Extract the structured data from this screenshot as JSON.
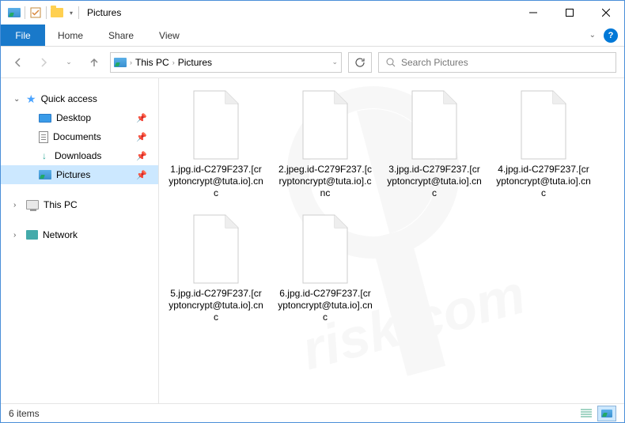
{
  "titlebar": {
    "title": "Pictures"
  },
  "ribbon": {
    "file": "File",
    "tabs": [
      "Home",
      "Share",
      "View"
    ]
  },
  "breadcrumb": [
    "This PC",
    "Pictures"
  ],
  "search": {
    "placeholder": "Search Pictures"
  },
  "sidebar": {
    "quick_access": "Quick access",
    "items": [
      {
        "label": "Desktop",
        "pinned": true
      },
      {
        "label": "Documents",
        "pinned": true
      },
      {
        "label": "Downloads",
        "pinned": true
      },
      {
        "label": "Pictures",
        "pinned": true,
        "selected": true
      }
    ],
    "this_pc": "This PC",
    "network": "Network"
  },
  "files": [
    {
      "name": "1.jpg.id-C279F237.[cryptoncrypt@tuta.io].cnc"
    },
    {
      "name": "2.jpeg.id-C279F237.[cryptoncrypt@tuta.io].cnc"
    },
    {
      "name": "3.jpg.id-C279F237.[cryptoncrypt@tuta.io].cnc"
    },
    {
      "name": "4.jpg.id-C279F237.[cryptoncrypt@tuta.io].cnc"
    },
    {
      "name": "5.jpg.id-C279F237.[cryptoncrypt@tuta.io].cnc"
    },
    {
      "name": "6.jpg.id-C279F237.[cryptoncrypt@tuta.io].cnc"
    }
  ],
  "statusbar": {
    "count": "6 items"
  }
}
